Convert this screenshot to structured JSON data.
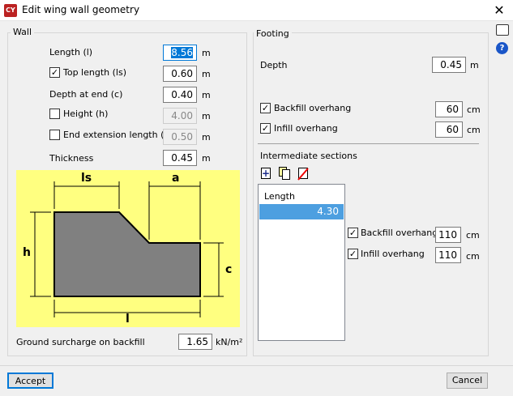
{
  "window": {
    "title": "Edit wing wall geometry",
    "close": "✕"
  },
  "wall": {
    "title": "Wall",
    "length_label": "Length (l)",
    "length": "8.56",
    "top_length_label": "Top length (ls)",
    "top_length": "0.60",
    "top_length_checked": true,
    "depth_end_label": "Depth at end (c)",
    "depth_end": "0.40",
    "height_label": "Height (h)",
    "height": "4.00",
    "height_checked": false,
    "end_ext_label": "End extension length (a)",
    "end_ext": "0.50",
    "end_ext_checked": false,
    "thickness_label": "Thickness",
    "thickness": "0.45",
    "unit": "m",
    "diagram": {
      "ls": "ls",
      "a": "a",
      "h": "h",
      "c": "c",
      "l": "l"
    },
    "surcharge_label": "Ground surcharge on backfill",
    "surcharge": "1.65",
    "surcharge_unit": "kN/m²"
  },
  "footing": {
    "title": "Footing",
    "depth_label": "Depth",
    "depth": "0.45",
    "depth_unit": "m",
    "backfill_label": "Backfill overhang",
    "backfill": "60",
    "infill_label": "Infill overhang",
    "infill": "60",
    "unit": "cm",
    "sections_title": "Intermediate sections",
    "list_header": "Length",
    "list_items": [
      "4.30"
    ],
    "sec_backfill_label": "Backfill overhang",
    "sec_backfill": "110",
    "sec_infill_label": "Infill overhang",
    "sec_infill": "110"
  },
  "buttons": {
    "accept": "Accept",
    "cancel": "Cancel"
  },
  "check": "✓"
}
